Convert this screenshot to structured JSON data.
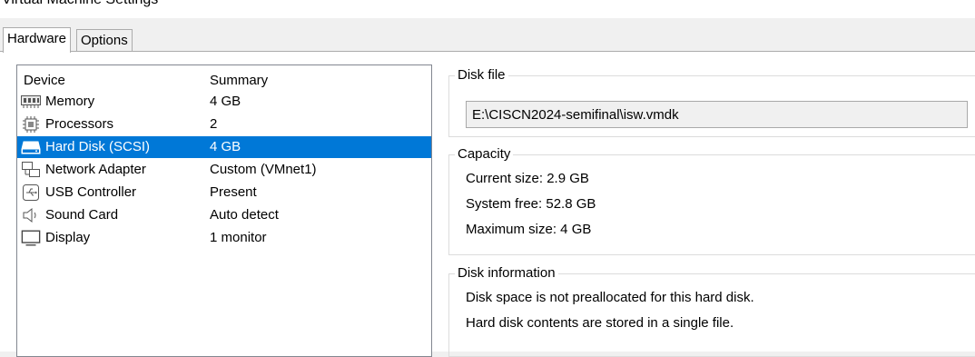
{
  "window": {
    "title": "Virtual Machine Settings"
  },
  "tabs": [
    {
      "label": "Hardware",
      "active": true
    },
    {
      "label": "Options",
      "active": false
    }
  ],
  "device_list": {
    "headers": {
      "device": "Device",
      "summary": "Summary"
    },
    "rows": [
      {
        "name": "Memory",
        "summary": "4 GB",
        "icon": "memory-icon",
        "selected": false
      },
      {
        "name": "Processors",
        "summary": "2",
        "icon": "processor-icon",
        "selected": false
      },
      {
        "name": "Hard Disk (SCSI)",
        "summary": "4 GB",
        "icon": "hard-disk-icon",
        "selected": true
      },
      {
        "name": "Network Adapter",
        "summary": "Custom (VMnet1)",
        "icon": "network-adapter-icon",
        "selected": false
      },
      {
        "name": "USB Controller",
        "summary": "Present",
        "icon": "usb-icon",
        "selected": false
      },
      {
        "name": "Sound Card",
        "summary": "Auto detect",
        "icon": "speaker-icon",
        "selected": false
      },
      {
        "name": "Display",
        "summary": "1 monitor",
        "icon": "monitor-icon",
        "selected": false
      }
    ]
  },
  "disk_file": {
    "label": "Disk file",
    "path": "E:\\CISCN2024-semifinal\\isw.vmdk"
  },
  "capacity": {
    "label": "Capacity",
    "current_size": "Current size: 2.9 GB",
    "system_free": "System free: 52.8 GB",
    "maximum_size": "Maximum size: 4 GB"
  },
  "disk_information": {
    "label": "Disk information",
    "line1": "Disk space is not preallocated for this hard disk.",
    "line2": "Hard disk contents are stored in a single file."
  },
  "colors": {
    "selection": "#0078d7",
    "panel_background": "#ffffff",
    "window_background": "#f0f0f0"
  }
}
